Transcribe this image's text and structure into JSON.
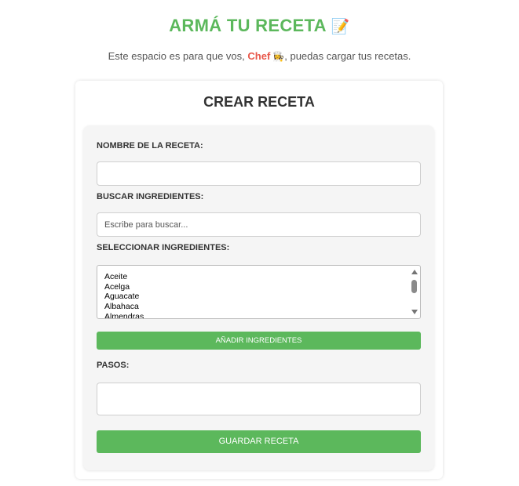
{
  "header": {
    "title": "ARMÁ TU RECETA",
    "title_emoji": "📝",
    "subtitle_before": "Este espacio es para que vos, ",
    "subtitle_highlight": "Chef",
    "subtitle_emoji": "👩‍🍳",
    "subtitle_after": ", puedas cargar tus recetas."
  },
  "card": {
    "title": "CREAR RECETA"
  },
  "form": {
    "recipe_name_label": "NOMBRE DE LA RECETA:",
    "recipe_name_value": "",
    "search_label": "BUSCAR INGREDIENTES:",
    "search_placeholder": "Escribe para buscar...",
    "select_label": "SELECCIONAR INGREDIENTES:",
    "ingredients": [
      "Aceite",
      "Acelga",
      "Aguacate",
      "Albahaca",
      "Almendras"
    ],
    "add_button": "AÑADIR INGREDIENTES",
    "steps_label": "PASOS:",
    "steps_value": "",
    "save_button": "GUARDAR RECETA"
  },
  "colors": {
    "accent_green": "#5cb85c",
    "chef_red": "#e8574a",
    "form_background": "#f5f5f5"
  }
}
